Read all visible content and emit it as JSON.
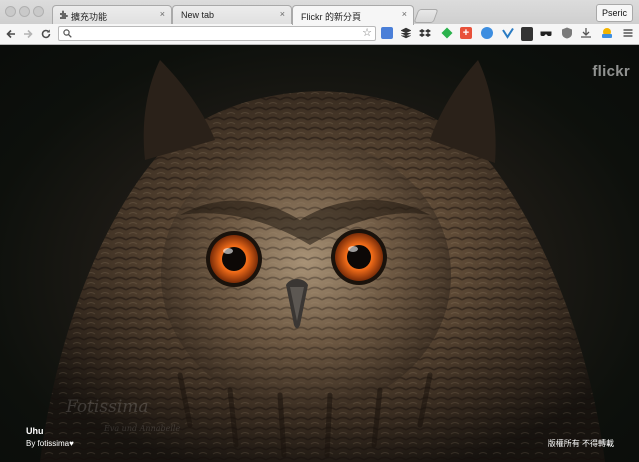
{
  "browser": {
    "tabs": [
      {
        "label": "擴充功能",
        "close": "×"
      },
      {
        "label": "New tab",
        "close": "×"
      },
      {
        "label": "Flickr 的新分頁",
        "close": "×"
      }
    ],
    "profile_name": "Pseric",
    "address_value": "",
    "icons": {
      "back": "back-arrow-icon",
      "forward": "forward-arrow-icon",
      "reload": "reload-icon",
      "star": "bookmark-star-icon",
      "menu": "menu-icon"
    }
  },
  "page": {
    "logo": "flickr",
    "photo_title": "Uhu",
    "photo_author": "By fotissima♥",
    "rights": "版權所有 不得轉載",
    "watermark": "Fotissima",
    "watermark_sub": "Eva und Annabelle"
  }
}
